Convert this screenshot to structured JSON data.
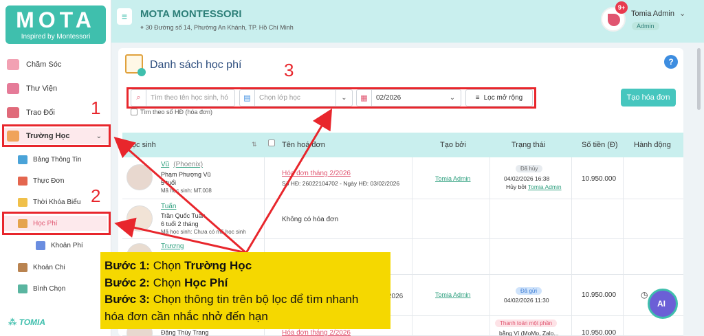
{
  "brand": {
    "logo_text": "MOTA",
    "logo_sub": "Inspired by Montessori",
    "footer": "TOMIA"
  },
  "header": {
    "school_name": "MOTA MONTESSORI",
    "address": "30 Đường số 14, Phường An Khánh, TP. Hồ Chí Minh",
    "notifications": "9+",
    "user_name": "Tomia Admin",
    "user_role": "Admin"
  },
  "sidebar": {
    "items": [
      {
        "label": "Chăm Sóc",
        "icon": "care-icon",
        "color": "#f2a1b3"
      },
      {
        "label": "Thư Viện",
        "icon": "library-icon",
        "color": "#e57b98"
      },
      {
        "label": "Trao Đổi",
        "icon": "chat-icon",
        "color": "#e06a7a"
      },
      {
        "label": "Trường Học",
        "icon": "school-icon",
        "color": "#f0a35a",
        "active": true
      }
    ],
    "sub_items": [
      {
        "label": "Bảng Thông Tin",
        "icon": "megaphone-icon",
        "color": "#4aa3d8"
      },
      {
        "label": "Thực Đơn",
        "icon": "menu-icon",
        "color": "#e4664f"
      },
      {
        "label": "Thời Khóa Biểu",
        "icon": "timetable-icon",
        "color": "#f0c04a"
      },
      {
        "label": "Học Phí",
        "icon": "fee-icon",
        "color": "#e5a44d",
        "active": true
      },
      {
        "label": "Khoản Phí",
        "icon": "books-icon",
        "color": "#6a8de0"
      }
    ],
    "bottom_items": [
      {
        "label": "Khoản Chi",
        "icon": "expense-icon",
        "color": "#b98350"
      },
      {
        "label": "Bình Chọn",
        "icon": "vote-icon",
        "color": "#5ab5a0"
      }
    ]
  },
  "page": {
    "title": "Danh sách học phí",
    "search_placeholder": "Tìm theo tên học sinh, hó",
    "class_placeholder": "Chọn lớp học",
    "month_value": "02/2026",
    "advanced_filter": "Lọc mở rộng",
    "create_button": "Tạo hóa đơn",
    "checkbox_label": "Tìm theo số HĐ (hóa đơn)"
  },
  "table": {
    "headers": [
      "Học sinh",
      "Tên hoá đơn",
      "Tạo bởi",
      "Trạng thái",
      "Số tiền (Đ)",
      "Hành động"
    ],
    "rows": [
      {
        "nickname": "Vũ",
        "group": "(Phoenix)",
        "full_name": "Phạm Phượng Vũ",
        "age": "5 tuổi",
        "code": "Mã học sinh: MT.008",
        "invoice_title": "Hóa đơn tháng 2/2026",
        "invoice_meta": "Số HĐ: 26022104702 - Ngày HĐ: 03/02/2026",
        "created_by": "Tomia Admin",
        "status": "Đã hủy",
        "status_time": "04/02/2026 16:38",
        "cancel_prefix": "Hủy bởi",
        "cancel_by": "Tomia Admin",
        "amount": "10.950.000"
      },
      {
        "nickname": "Tuấn",
        "full_name": "Trần Quốc Tuấn",
        "age": "6 tuổi 2 tháng",
        "code": "Mã học sinh: Chưa có mã học sinh",
        "no_invoice": "Không có hóa đơn"
      },
      {
        "nickname": "Trương"
      },
      {
        "invoice_title_tail": "2026",
        "created_by": "Tomia Admin",
        "status": "Đã gửi",
        "status_time": "04/02/2026 11:30",
        "amount": "10.950.000"
      },
      {
        "full_name": "Đặng Thùy Trang",
        "invoice_title": "Hóa đơn tháng 2/2026",
        "status": "Thanh toán một phần",
        "status_extra": "bằng Ví (MoMo, Zalo...",
        "amount": "10.950.000"
      }
    ]
  },
  "annotations": {
    "n1": "1",
    "n2": "2",
    "n3": "3",
    "step1_prefix": "Bước 1:",
    "step1_text": "Chọn ",
    "step1_bold": "Trường Học",
    "step2_prefix": "Bước 2:",
    "step2_text": "Chọn ",
    "step2_bold": "Học Phí",
    "step3_prefix": "Bước 3:",
    "step3_text": "Chọn thông tin trên bộ lọc để tìm nhanh",
    "step3_line2": "hóa đơn cần nhắc nhở đến hạn"
  },
  "colors": {
    "accent": "#3fbfad",
    "annotation_red": "#e8262c",
    "callout": "#f5d800",
    "header_bg": "#c9efee"
  }
}
